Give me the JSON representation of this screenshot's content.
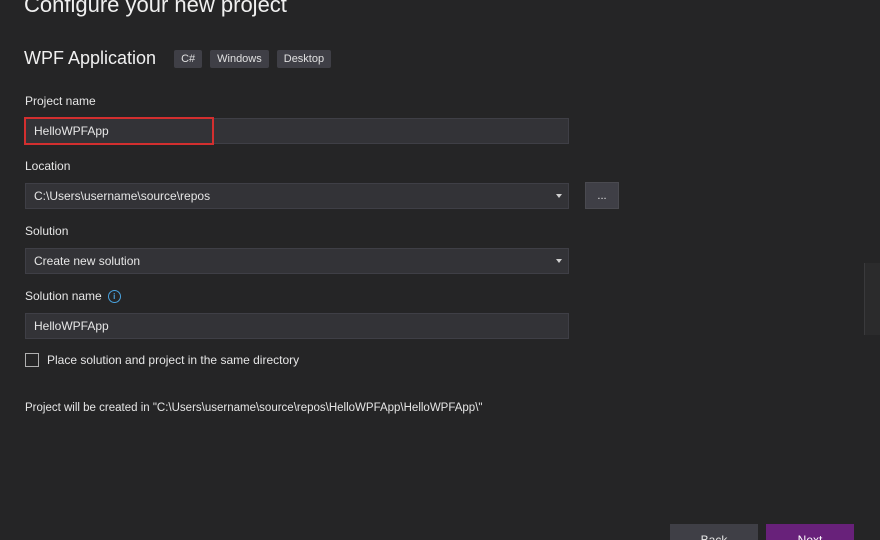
{
  "header": {
    "title": "Configure your new project",
    "template_name": "WPF Application",
    "tags": [
      "C#",
      "Windows",
      "Desktop"
    ]
  },
  "form": {
    "project_name_label": "Project name",
    "project_name_value": "HelloWPFApp",
    "location_label": "Location",
    "location_value": "C:\\Users\\username\\source\\repos",
    "browse_label": "...",
    "solution_label": "Solution",
    "solution_value": "Create new solution",
    "solution_name_label": "Solution name",
    "solution_name_value": "HelloWPFApp",
    "same_directory_label": "Place solution and project in the same directory",
    "same_directory_checked": false,
    "path_note": "Project will be created in \"C:\\Users\\username\\source\\repos\\HelloWPFApp\\HelloWPFApp\\\""
  },
  "footer": {
    "back_label": "Back",
    "next_label": "Next"
  },
  "colors": {
    "background": "#252526",
    "field_background": "#333337",
    "highlight": "#d32f2f",
    "next_button": "#68217a",
    "info_icon": "#4aa3df"
  },
  "icons": {
    "info": "info-icon",
    "dropdown": "chevron-down-icon"
  }
}
